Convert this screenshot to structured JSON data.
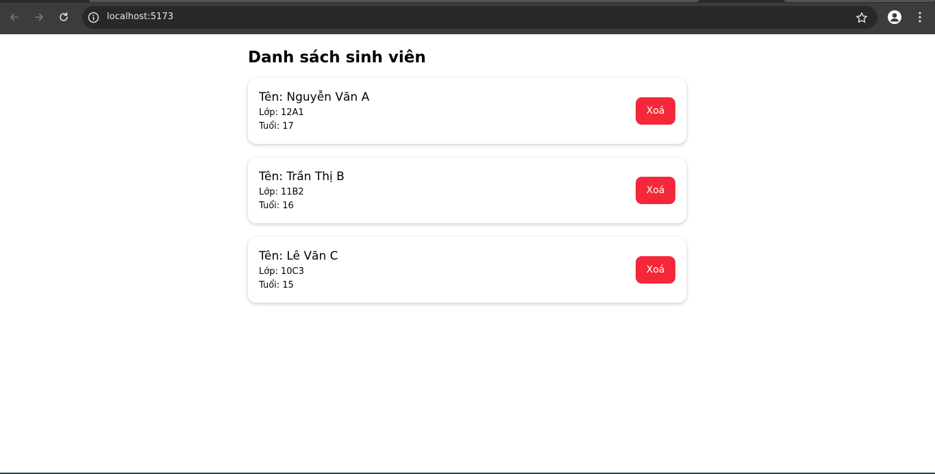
{
  "browser": {
    "url": "localhost:5173"
  },
  "page": {
    "title": "Danh sách sinh viên",
    "delete_label": "Xoá",
    "students": [
      {
        "name": "Tên: Nguyễn Văn A",
        "class": "Lớp: 12A1",
        "age": "Tuổi: 17"
      },
      {
        "name": "Tên: Trần Thị B",
        "class": "Lớp: 11B2",
        "age": "Tuổi: 16"
      },
      {
        "name": "Tên: Lê Văn C",
        "class": "Lớp: 10C3",
        "age": "Tuổi: 15"
      }
    ]
  },
  "colors": {
    "delete_button": "#f4283a",
    "chrome_bg": "#3c3c3c",
    "omnibox_bg": "#282828"
  }
}
